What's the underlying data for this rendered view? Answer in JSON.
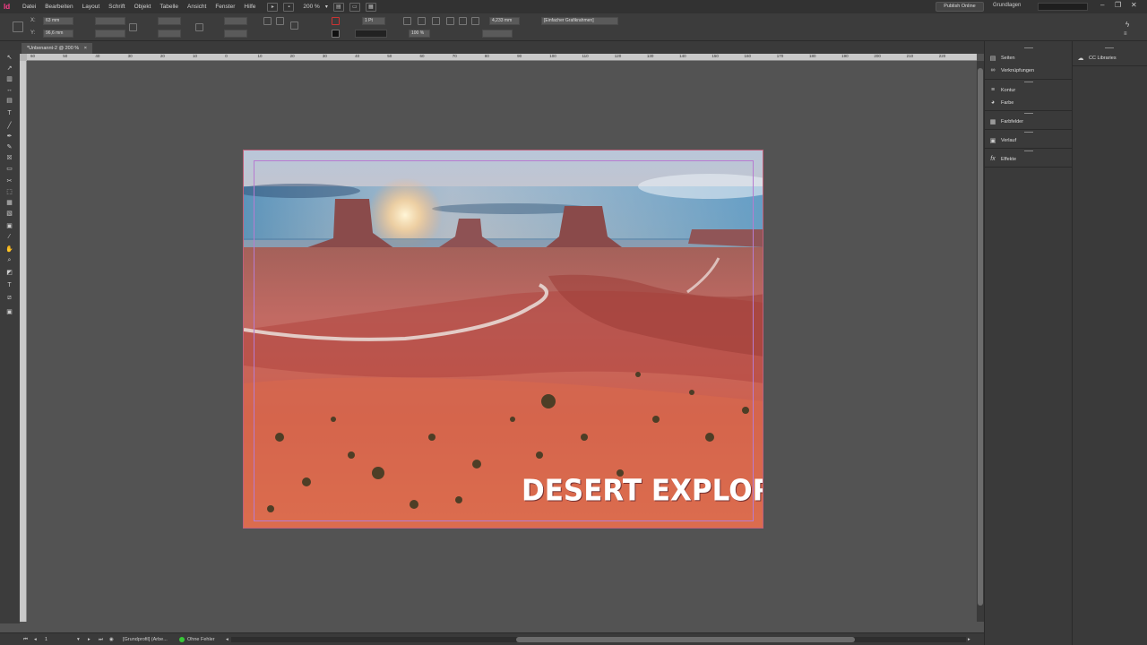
{
  "menubar": {
    "app_logo": "Id",
    "items": [
      "Datei",
      "Bearbeiten",
      "Layout",
      "Schrift",
      "Objekt",
      "Tabelle",
      "Ansicht",
      "Fenster",
      "Hilfe"
    ],
    "zoom": "200 %",
    "publish_label": "Publish Online",
    "workspace": "Grundlagen"
  },
  "control": {
    "x_label": "X:",
    "x_value": "63 mm",
    "y_label": "Y:",
    "y_value": "96,6 mm",
    "stroke_weight": "1 Pt",
    "opacity": "100 %",
    "offset_value": "4,233 mm",
    "style_value": "[Einfacher Grafikrahmen]"
  },
  "document": {
    "tab_title": "*Unbenannt-2 @ 200 %",
    "title_text": "DESERT EXPLORER",
    "ruler_labels": [
      "60",
      "50",
      "40",
      "30",
      "20",
      "10",
      "0",
      "10",
      "20",
      "30",
      "40",
      "50",
      "60",
      "70",
      "80",
      "90",
      "100",
      "110",
      "120",
      "130",
      "140",
      "150",
      "160",
      "170",
      "180",
      "190",
      "200",
      "210",
      "220"
    ]
  },
  "status": {
    "page": "1",
    "profile": "[Grundprofil] (Arbe...",
    "errors": "Ohne Fehler"
  },
  "panels": {
    "col1": [
      {
        "icon": "pages-icon",
        "label": "Seiten"
      },
      {
        "icon": "links-icon",
        "label": "Verknüpfungen"
      },
      {
        "icon": "stroke-icon",
        "label": "Kontur"
      },
      {
        "icon": "color-icon",
        "label": "Farbe"
      },
      {
        "icon": "swatches-icon",
        "label": "Farbfelder"
      },
      {
        "icon": "gradient-icon",
        "label": "Verlauf"
      },
      {
        "icon": "effects-icon",
        "label": "Effekte"
      }
    ],
    "col2": [
      {
        "icon": "cc-libraries-icon",
        "label": "CC Libraries"
      }
    ]
  },
  "colors": {
    "accent": "#ff3d8b",
    "frame": "#c0607a",
    "margin": "#b77bd0"
  }
}
